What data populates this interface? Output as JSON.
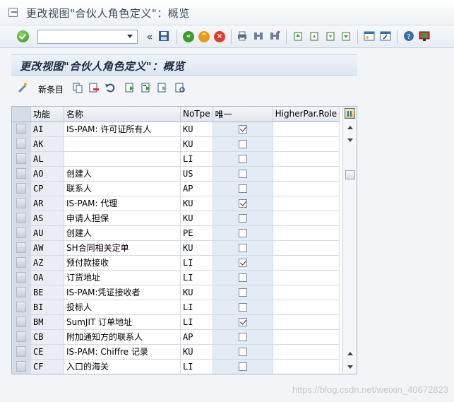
{
  "window": {
    "title": "更改视图\"合伙人角色定义\"：概览"
  },
  "command_field": {
    "value": "",
    "placeholder": ""
  },
  "page": {
    "heading": "更改视图\"合伙人角色定义\"：概览"
  },
  "app_toolbar": {
    "new_entries_label": "新条目"
  },
  "table": {
    "columns": [
      "功能",
      "名称",
      "NoTpe",
      "唯一",
      "HigherPar.Role"
    ],
    "rows": [
      {
        "code": "AI",
        "name": "IS-PAM: 许可证所有人",
        "type": "KU",
        "unique": true
      },
      {
        "code": "AK",
        "name": "",
        "type": "KU",
        "unique": false
      },
      {
        "code": "AL",
        "name": "",
        "type": "LI",
        "unique": false
      },
      {
        "code": "AO",
        "name": "创建人",
        "type": "US",
        "unique": false
      },
      {
        "code": "CP",
        "name": "联系人",
        "type": "AP",
        "unique": false
      },
      {
        "code": "AR",
        "name": "IS-PAM: 代理",
        "type": "KU",
        "unique": true
      },
      {
        "code": "AS",
        "name": "申请人担保",
        "type": "KU",
        "unique": false
      },
      {
        "code": "AU",
        "name": "创建人",
        "type": "PE",
        "unique": false
      },
      {
        "code": "AW",
        "name": "SH合同相关定单",
        "type": "KU",
        "unique": false
      },
      {
        "code": "AZ",
        "name": "预付款接收",
        "type": "LI",
        "unique": true
      },
      {
        "code": "OA",
        "name": "订货地址",
        "type": "LI",
        "unique": false
      },
      {
        "code": "BE",
        "name": "IS-PAM:凭证接收者",
        "type": "KU",
        "unique": false
      },
      {
        "code": "BI",
        "name": "投标人",
        "type": "LI",
        "unique": false
      },
      {
        "code": "BM",
        "name": "SumJIT 订单地址",
        "type": "LI",
        "unique": true
      },
      {
        "code": "CB",
        "name": "附加通知方的联系人",
        "type": "AP",
        "unique": false
      },
      {
        "code": "CE",
        "name": "IS-PAM: Chiffre 记录",
        "type": "KU",
        "unique": false
      },
      {
        "code": "CF",
        "name": "入口的海关",
        "type": "LI",
        "unique": false
      }
    ]
  },
  "watermark": "https://blog.csdn.net/weixin_40672823"
}
